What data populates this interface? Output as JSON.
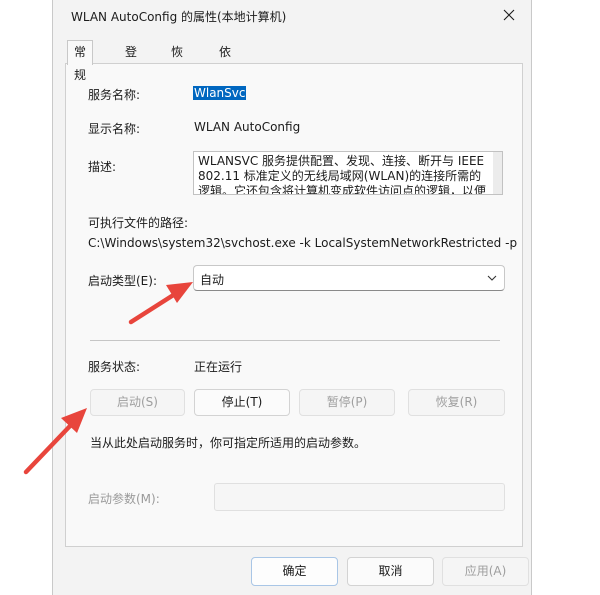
{
  "window": {
    "title": "WLAN AutoConfig 的属性(本地计算机)"
  },
  "tabs": [
    {
      "label": "常规"
    },
    {
      "label": "登录"
    },
    {
      "label": "恢复"
    },
    {
      "label": "依存关系"
    }
  ],
  "general": {
    "service_name_label": "服务名称:",
    "service_name_value": "WlanSvc",
    "display_name_label": "显示名称:",
    "display_name_value": "WLAN AutoConfig",
    "description_label": "描述:",
    "description_value": "WLANSVC 服务提供配置、发现、连接、断开与 IEEE 802.11 标准定义的无线局域网(WLAN)的连接所需的逻辑。它还包含将计算机变成软件访问点的逻辑，以便",
    "exe_path_label": "可执行文件的路径:",
    "exe_path_value": "C:\\Windows\\system32\\svchost.exe -k LocalSystemNetworkRestricted -p",
    "startup_type_label": "启动类型(E):",
    "startup_type_value": "自动",
    "service_status_label": "服务状态:",
    "service_status_value": "正在运行",
    "buttons": {
      "start": "启动(S)",
      "stop": "停止(T)",
      "pause": "暂停(P)",
      "resume": "恢复(R)"
    },
    "hint": "当从此处启动服务时，你可指定所适用的启动参数。",
    "start_params_label": "启动参数(M):",
    "start_params_value": ""
  },
  "footer": {
    "ok": "确定",
    "cancel": "取消",
    "apply": "应用(A)"
  },
  "colors": {
    "selection": "#0067c0",
    "annotation_arrow": "#e8453c"
  }
}
